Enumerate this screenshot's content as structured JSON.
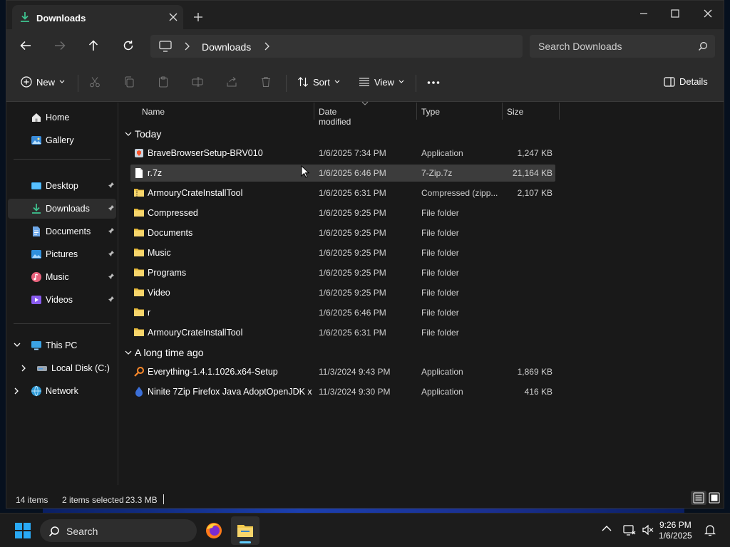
{
  "window": {
    "tab_title": "Downloads",
    "controls": [
      "minimize",
      "maximize",
      "close"
    ]
  },
  "address": {
    "crumb": "Downloads",
    "search_placeholder": "Search Downloads"
  },
  "toolbar": {
    "new_label": "New",
    "sort_label": "Sort",
    "view_label": "View",
    "details_label": "Details"
  },
  "sidebar": {
    "home": "Home",
    "gallery": "Gallery",
    "desktop": "Desktop",
    "downloads": "Downloads",
    "documents": "Documents",
    "pictures": "Pictures",
    "music": "Music",
    "videos": "Videos",
    "this_pc": "This PC",
    "local_disk": "Local Disk (C:)",
    "network": "Network"
  },
  "columns": {
    "name": "Name",
    "date": "Date modified",
    "type": "Type",
    "size": "Size"
  },
  "groups": {
    "today": "Today",
    "long_ago": "A long time ago"
  },
  "files": [
    {
      "name": "BraveBrowserSetup-BRV010",
      "date": "1/6/2025 7:34 PM",
      "type": "Application",
      "size": "1,247 KB",
      "icon": "installer-icon"
    },
    {
      "name": "r.7z",
      "date": "1/6/2025 6:46 PM",
      "type": "7-Zip.7z",
      "size": "21,164 KB",
      "icon": "file-icon",
      "selected": true
    },
    {
      "name": "ArmouryCrateInstallTool",
      "date": "1/6/2025 6:31 PM",
      "type": "Compressed (zipp...",
      "size": "2,107 KB",
      "icon": "zip-folder-icon"
    },
    {
      "name": "Compressed",
      "date": "1/6/2025 9:25 PM",
      "type": "File folder",
      "size": "",
      "icon": "folder-icon"
    },
    {
      "name": "Documents",
      "date": "1/6/2025 9:25 PM",
      "type": "File folder",
      "size": "",
      "icon": "folder-icon"
    },
    {
      "name": "Music",
      "date": "1/6/2025 9:25 PM",
      "type": "File folder",
      "size": "",
      "icon": "folder-icon"
    },
    {
      "name": "Programs",
      "date": "1/6/2025 9:25 PM",
      "type": "File folder",
      "size": "",
      "icon": "folder-icon"
    },
    {
      "name": "Video",
      "date": "1/6/2025 9:25 PM",
      "type": "File folder",
      "size": "",
      "icon": "folder-icon"
    },
    {
      "name": "r",
      "date": "1/6/2025 6:46 PM",
      "type": "File folder",
      "size": "",
      "icon": "folder-icon"
    },
    {
      "name": "ArmouryCrateInstallTool",
      "date": "1/6/2025 6:31 PM",
      "type": "File folder",
      "size": "",
      "icon": "folder-icon"
    },
    {
      "name": "Everything-1.4.1.1026.x64-Setup",
      "date": "11/3/2024 9:43 PM",
      "type": "Application",
      "size": "1,869 KB",
      "icon": "magnifier-app-icon"
    },
    {
      "name": "Ninite 7Zip Firefox Java AdoptOpenJDK x...",
      "date": "11/3/2024 9:30 PM",
      "type": "Application",
      "size": "416 KB",
      "icon": "ninite-icon"
    }
  ],
  "status": {
    "count": "14 items",
    "selection": "2 items selected",
    "size": "23.3 MB"
  },
  "taskbar": {
    "search_label": "Search",
    "time": "9:26 PM",
    "date": "1/6/2025"
  },
  "colors": {
    "accent": "#60cdff",
    "folder": "#f2c94c",
    "selected_row": "#3c3c3c"
  }
}
